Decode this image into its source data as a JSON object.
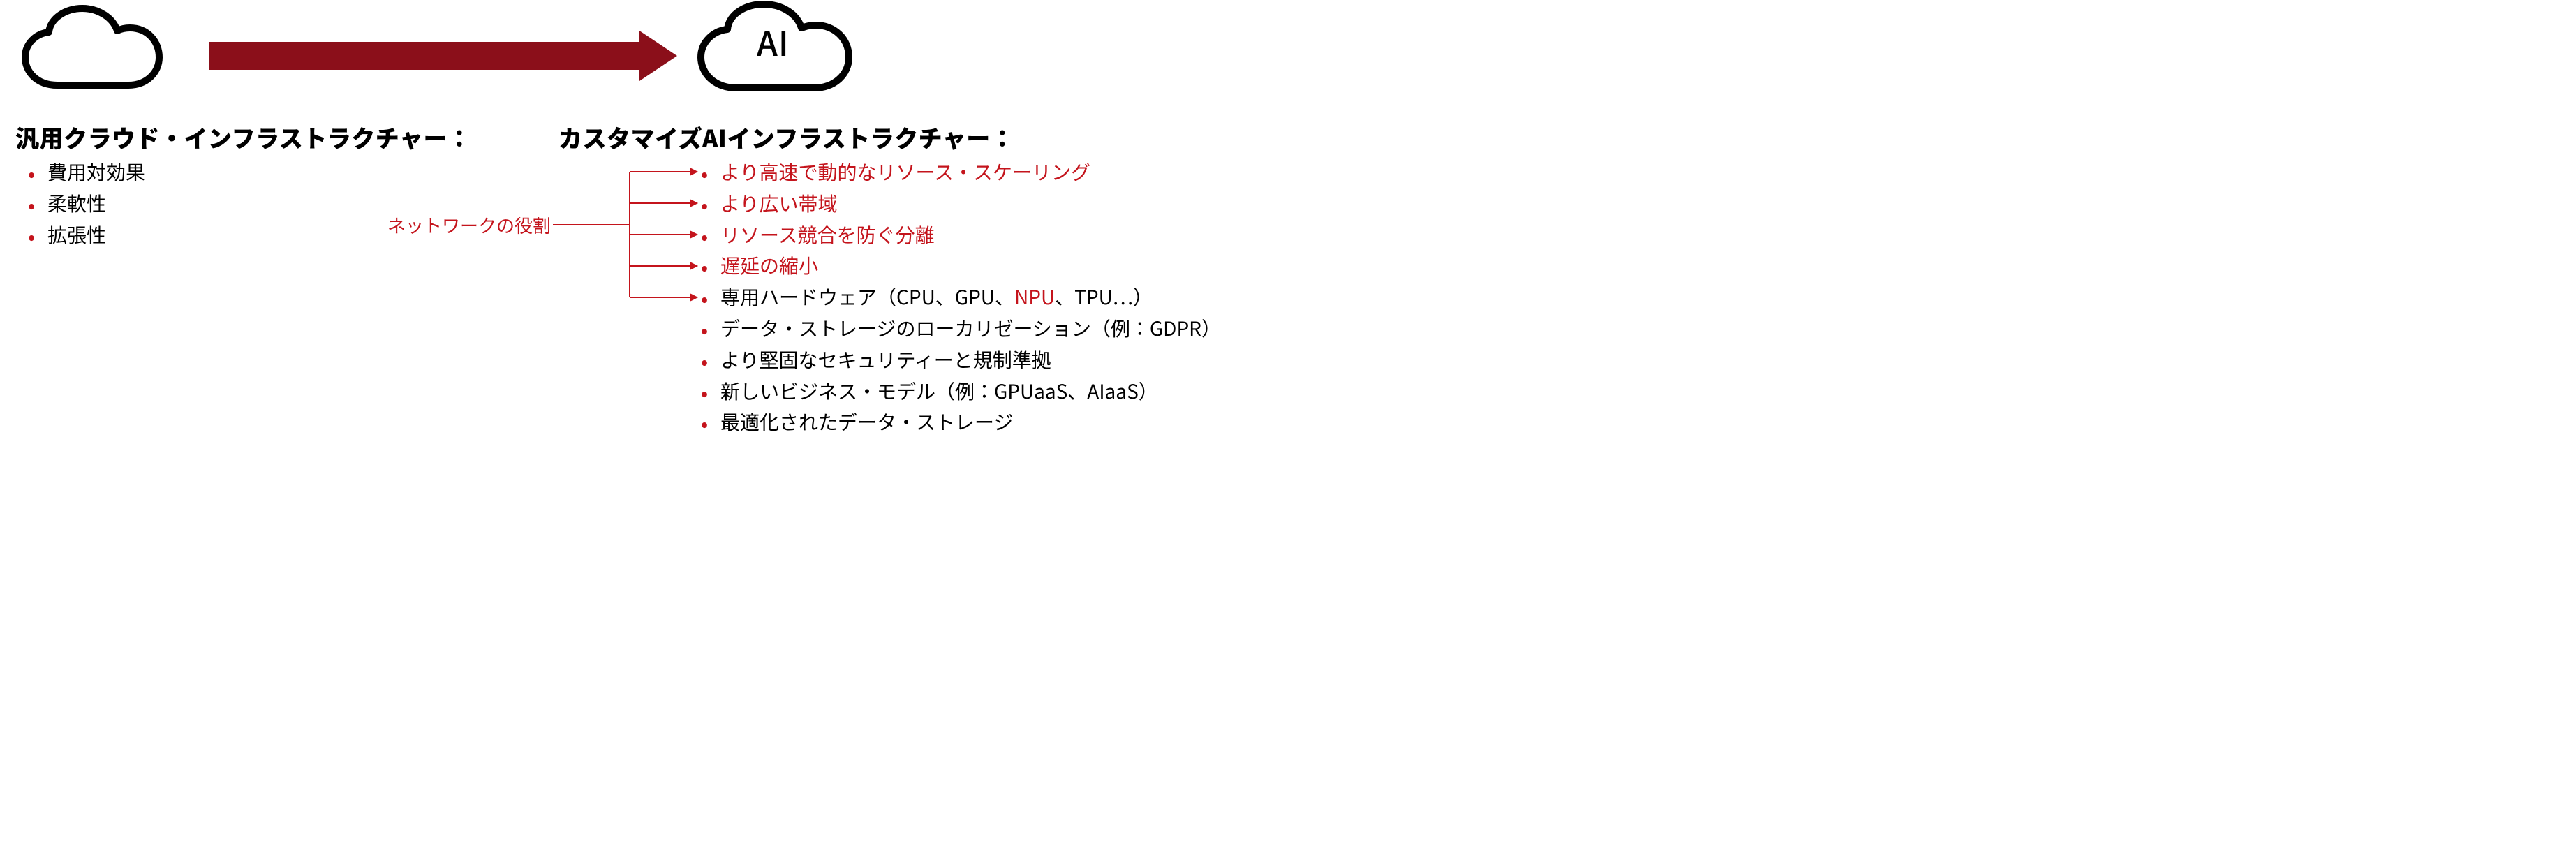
{
  "colors": {
    "arrow": "#8b0f1a",
    "accent_red": "#c4141c",
    "stroke_black": "#000000"
  },
  "left": {
    "cloud_label": "",
    "heading": "汎用クラウド・インフラストラクチャー：",
    "bullets": [
      "費用対効果",
      "柔軟性",
      "拡張性"
    ]
  },
  "right": {
    "cloud_label": "AI",
    "heading": "カスタマイズAIインフラストラクチャー：",
    "bullets": [
      {
        "text": "より高速で動的なリソース・スケーリング",
        "red": true,
        "linked": true
      },
      {
        "text": "より広い帯域",
        "red": true,
        "linked": true
      },
      {
        "text": "リソース競合を防ぐ分離",
        "red": true,
        "linked": true
      },
      {
        "text": "遅延の縮小",
        "red": true,
        "linked": true
      },
      {
        "pre": "専用ハードウェア（CPU、GPU、",
        "mid": "NPU",
        "post": "、TPU…）",
        "red": false,
        "linked": true
      },
      {
        "text": "データ・ストレージのローカリゼーション（例：GDPR）",
        "red": false,
        "linked": false
      },
      {
        "text": "より堅固なセキュリティーと規制準拠",
        "red": false,
        "linked": false
      },
      {
        "text": "新しいビジネス・モデル（例：GPUaaS、AIaaS）",
        "red": false,
        "linked": false
      },
      {
        "text": "最適化されたデータ・ストレージ",
        "red": false,
        "linked": false
      }
    ]
  },
  "connector_label": "ネットワークの役割"
}
